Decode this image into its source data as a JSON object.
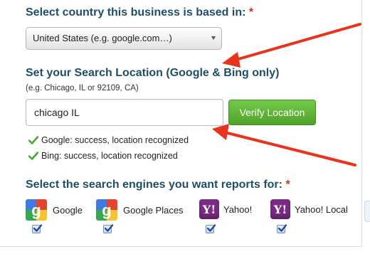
{
  "country": {
    "heading": "Select country this business is based in:",
    "required_mark": "*",
    "selected": "United States (e.g. google.com…)"
  },
  "location": {
    "heading": "Set your Search Location (Google & Bing only)",
    "hint": "(e.g. Chicago, IL or 92109, CA)",
    "value": "chicago IL",
    "verify_label": "Verify Location",
    "statuses": [
      "Google: success, location recognized",
      "Bing: success, location recognized"
    ]
  },
  "engines": {
    "heading": "Select the search engines you want reports for:",
    "required_mark": "*",
    "items": [
      {
        "label": "Google",
        "icon": "google-icon",
        "checked": true
      },
      {
        "label": "Google Places",
        "icon": "google-places-icon",
        "checked": true
      },
      {
        "label": "Yahoo!",
        "icon": "yahoo-icon",
        "checked": true
      },
      {
        "label": "Yahoo! Local",
        "icon": "yahoo-local-icon",
        "checked": true
      }
    ]
  },
  "colors": {
    "heading": "#1f4e67",
    "required": "#d62b1c",
    "verify_button": "#5cb434",
    "annotation_arrow": "#e8341c",
    "yahoo": "#7b2c84"
  }
}
